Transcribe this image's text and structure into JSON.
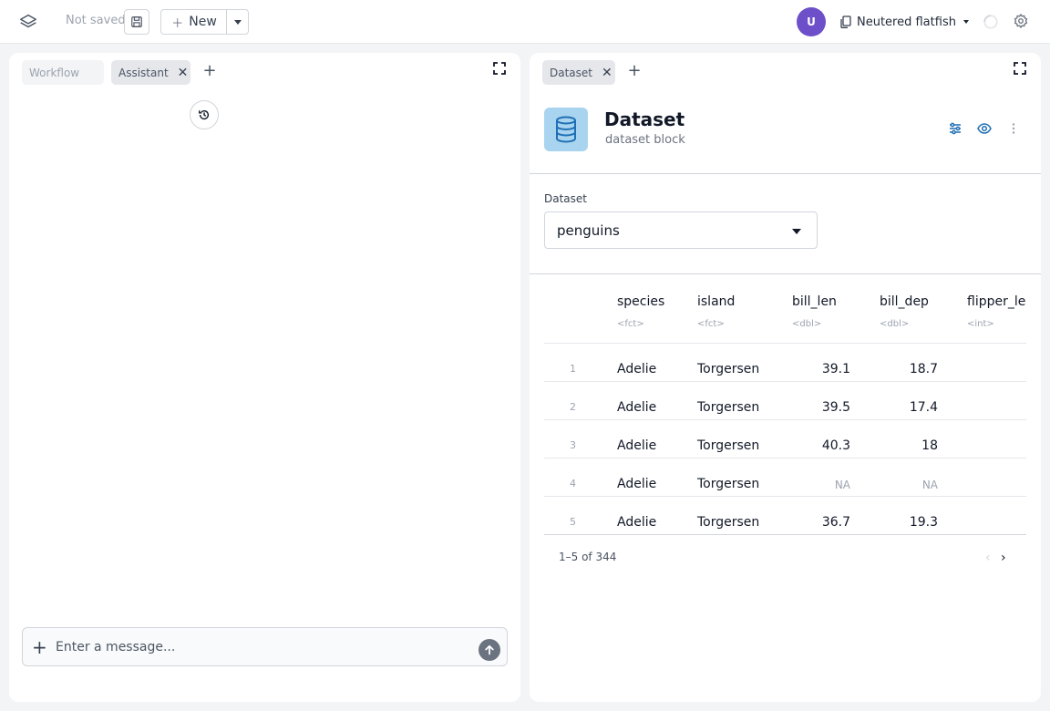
{
  "topbar": {
    "status": "Not saved",
    "new_label": "New",
    "avatar_initial": "U",
    "project_name": "Neutered flatfish"
  },
  "left_panel": {
    "tabs": [
      {
        "label": "Workflow",
        "active": false
      },
      {
        "label": "Assistant",
        "active": true,
        "closable": true
      }
    ],
    "message_placeholder": "Enter a message..."
  },
  "right_panel": {
    "tabs": [
      {
        "label": "Dataset",
        "active": true,
        "closable": true
      }
    ],
    "block": {
      "title": "Dataset",
      "subtitle": "dataset block",
      "icon": "database-icon"
    },
    "dataset_field": {
      "label": "Dataset",
      "selected": "penguins"
    },
    "table": {
      "columns": [
        {
          "name": "species",
          "type": "<fct>"
        },
        {
          "name": "island",
          "type": "<fct>"
        },
        {
          "name": "bill_len",
          "type": "<dbl>"
        },
        {
          "name": "bill_dep",
          "type": "<dbl>"
        },
        {
          "name": "flipper_len",
          "type": "<int>"
        }
      ],
      "rows": [
        {
          "n": "1",
          "species": "Adelie",
          "island": "Torgersen",
          "bill_len": "39.1",
          "bill_dep": "18.7"
        },
        {
          "n": "2",
          "species": "Adelie",
          "island": "Torgersen",
          "bill_len": "39.5",
          "bill_dep": "17.4"
        },
        {
          "n": "3",
          "species": "Adelie",
          "island": "Torgersen",
          "bill_len": "40.3",
          "bill_dep": "18"
        },
        {
          "n": "4",
          "species": "Adelie",
          "island": "Torgersen",
          "bill_len": "NA",
          "bill_dep": "NA"
        },
        {
          "n": "5",
          "species": "Adelie",
          "island": "Torgersen",
          "bill_len": "36.7",
          "bill_dep": "19.3"
        }
      ]
    },
    "pager": {
      "summary": "1–5 of 344",
      "prev": "‹",
      "next": "›"
    }
  },
  "colors": {
    "avatar": "#6d4fc9",
    "accent": "#1f6fb5",
    "block_icon_bg": "#a9d4ef"
  }
}
